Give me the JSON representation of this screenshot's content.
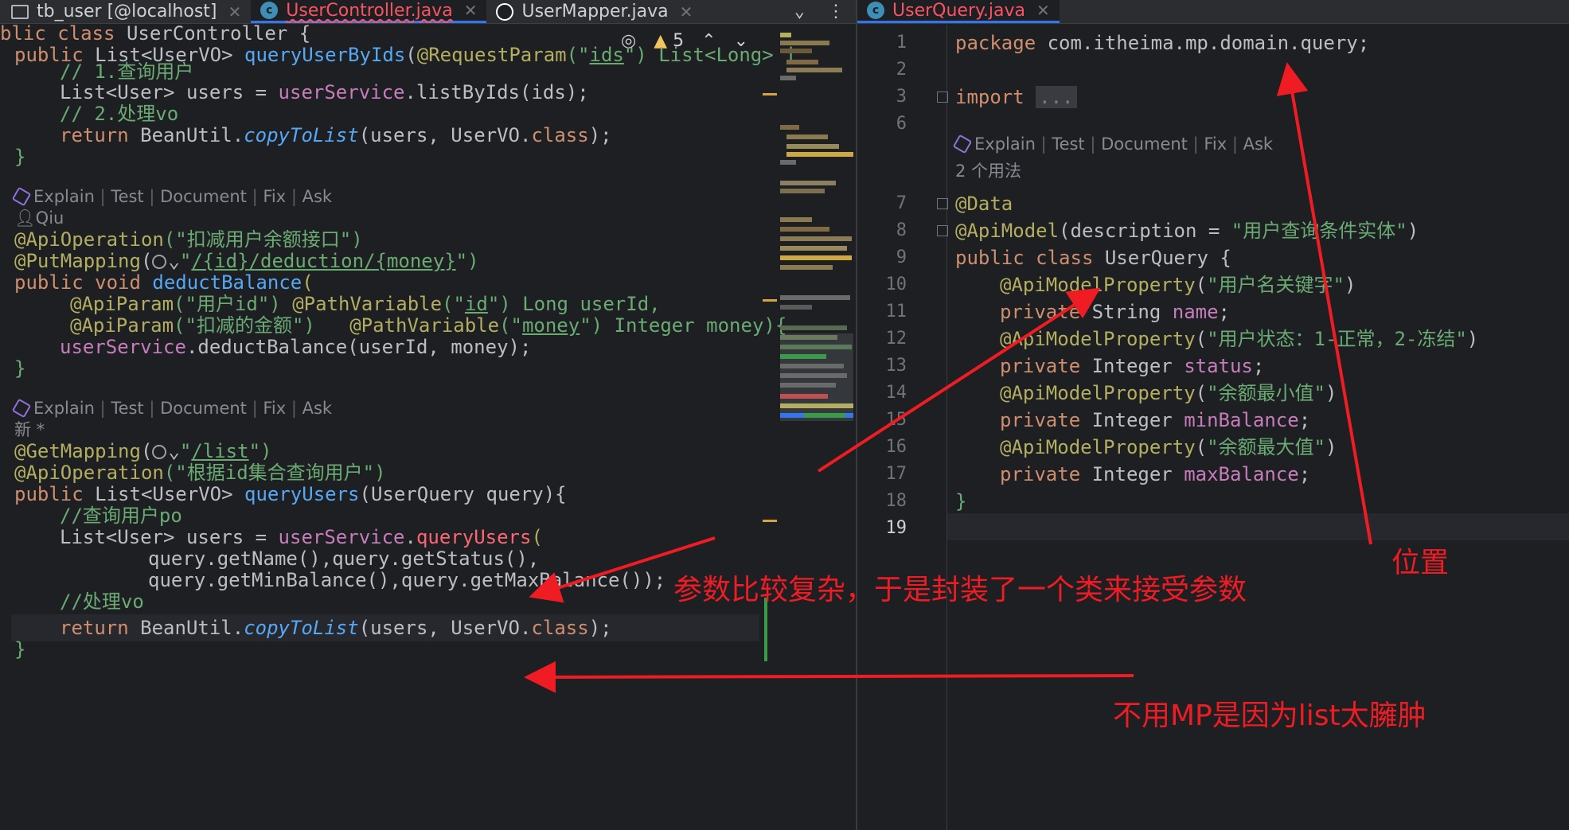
{
  "tabs_left": [
    {
      "icon": "table-icon",
      "label": "tb_user [@localhost]",
      "state": "normal"
    },
    {
      "icon": "class-icon",
      "label": "UserController.java",
      "state": "active-error"
    },
    {
      "icon": "mapper-icon",
      "label": "UserMapper.java",
      "state": "normal"
    }
  ],
  "tabs_right": [
    {
      "icon": "class-icon",
      "label": "UserQuery.java",
      "state": "active-error"
    }
  ],
  "close_glyph": "✕",
  "inspection": {
    "warnings": "5"
  },
  "left_code": {
    "l1_a": "blic class ",
    "l1_b": "UserController {",
    "l2_a": "public ",
    "l2_b": "List<UserVO> ",
    "l2_c": "queryUserByIds",
    "l2_d": "(",
    "l2_e": "@RequestParam",
    "l2_f": "(\"",
    "l2_g": "ids",
    "l2_h": "\") List<Long> i",
    "l3": "// 1.查询用户",
    "l4_a": "List<User> users = ",
    "l4_b": "userService",
    "l4_c": ".listByIds(ids);",
    "l5": "// 2.处理vo",
    "l6_a": "return ",
    "l6_b": "BeanUtil.",
    "l6_c": "copyToList",
    "l6_d": "(users, UserVO.",
    "l6_e": "class",
    "l6_f": ");",
    "l7": "}",
    "ann1": [
      "Explain",
      "Test",
      "Document",
      "Fix",
      "Ask"
    ],
    "author": "Qiu",
    "l8_a": "@ApiOperation",
    "l8_b": "(\"扣减用户余额接口\")",
    "l9_a": "@PutMapping",
    "l9_b": "(",
    "l9_c": "\"",
    "l9_d": "/{id}/deduction/{money}",
    "l9_e": "\")",
    "l10_a": "public void ",
    "l10_b": "deductBalance",
    "l10_c": "(",
    "l11_a": "@ApiParam",
    "l11_b": "(\"用户id\") ",
    "l11_c": "@PathVariable",
    "l11_d": "(\"",
    "l11_e": "id",
    "l11_f": "\") Long userId,",
    "l12_a": "@ApiParam",
    "l12_b": "(\"扣减的金额\")   ",
    "l12_c": "@PathVariable",
    "l12_d": "(\"",
    "l12_e": "money",
    "l12_f": "\") Integer money){",
    "l13_a": "userService",
    "l13_b": ".deductBalance(userId, money);",
    "l14": "}",
    "ann2": [
      "Explain",
      "Test",
      "Document",
      "Fix",
      "Ask"
    ],
    "newmark": "新 *",
    "l15_a": "@GetMapping",
    "l15_b": "(",
    "l15_c": "\"",
    "l15_d": "/list",
    "l15_e": "\")",
    "l16_a": "@ApiOperation",
    "l16_b": "(\"根据id集合查询用户\")",
    "l17_a": "public ",
    "l17_b": "List<UserVO> ",
    "l17_c": "queryUsers",
    "l17_d": "(UserQuery query){",
    "l18": "//查询用户po",
    "l19_a": "List<User> users = ",
    "l19_b": "userService",
    "l19_c": ".",
    "l19_d": "queryUsers",
    "l19_e": "(",
    "l20": "query.getName(),query.getStatus(),",
    "l21": "query.getMinBalance(),query.getMaxBalance());",
    "l22": "//处理vo",
    "l23_a": "return ",
    "l23_b": "BeanUtil.",
    "l23_c": "copyToList",
    "l23_d": "(users, UserVO.",
    "l23_e": "class",
    "l23_f": ");",
    "l24": "}"
  },
  "right_code": {
    "line_numbers": [
      "1",
      "2",
      "3",
      "6",
      "7",
      "8",
      "9",
      "10",
      "11",
      "12",
      "13",
      "14",
      "15",
      "16",
      "17",
      "18",
      "19"
    ],
    "r1_a": "package ",
    "r1_b": "com.itheima.mp.domain.query;",
    "r3_a": "import ",
    "r3_b": "...",
    "ann": [
      "Explain",
      "Test",
      "Document",
      "Fix",
      "Ask"
    ],
    "usages": "2 个用法",
    "r7": "@Data",
    "r8_a": "@ApiModel",
    "r8_b": "(description = ",
    "r8_c": "\"用户查询条件实体\"",
    "r8_d": ")",
    "r9_a": "public class ",
    "r9_b": "UserQuery {",
    "r10_a": "@ApiModelProperty",
    "r10_b": "(",
    "r10_c": "\"用户名关键字\"",
    "r10_d": ")",
    "r11_a": "private ",
    "r11_b": "String ",
    "r11_c": "name",
    "r11_d": ";",
    "r12_a": "@ApiModelProperty",
    "r12_b": "(",
    "r12_c": "\"用户状态：1-正常，2-冻结\"",
    "r12_d": ")",
    "r13_a": "private ",
    "r13_b": "Integer ",
    "r13_c": "status",
    "r13_d": ";",
    "r14_a": "@ApiModelProperty",
    "r14_b": "(",
    "r14_c": "\"余额最小值\"",
    "r14_d": ")",
    "r15_a": "private ",
    "r15_b": "Integer ",
    "r15_c": "minBalance",
    "r15_d": ";",
    "r16_a": "@ApiModelProperty",
    "r16_b": "(",
    "r16_c": "\"余额最大值\"",
    "r16_d": ")",
    "r17_a": "private ",
    "r17_b": "Integer ",
    "r17_c": "maxBalance",
    "r17_d": ";",
    "r18": "}"
  },
  "notes": {
    "position": "位置",
    "params": "参数比较复杂，于是封装了一个类来接受参数",
    "no_mp": "不用MP是因为list太臃肿"
  },
  "colors": {
    "annotation": "#f01c24",
    "keyword": "#cf8e6d",
    "string": "#6aab73",
    "method": "#56a8f5",
    "annotation_kw": "#b3ae60",
    "field": "#c77dbb"
  }
}
